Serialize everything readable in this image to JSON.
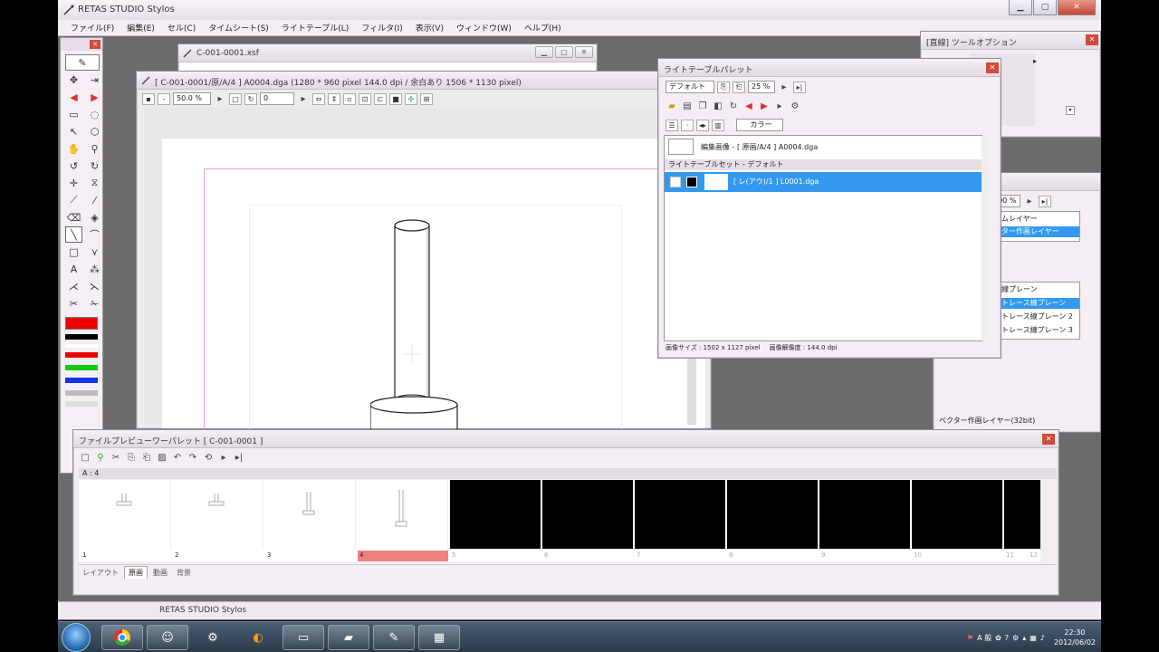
{
  "app": {
    "title": "RETAS STUDIO Stylos",
    "status": "RETAS STUDIO Stylos",
    "menus": [
      "ファイル(F)",
      "編集(E)",
      "セル(C)",
      "タイムシート(S)",
      "ライトテーブル(L)",
      "フィルタ(I)",
      "表示(V)",
      "ウィンドウ(W)",
      "ヘルプ(H)"
    ]
  },
  "xsf_window": {
    "title": "C-001-0001.xsf"
  },
  "doc_window": {
    "title": "[ C-001-0001/原/A/4 ] A0004.dga (1280 * 960 pixel 144.0 dpi / 余白あり 1506 * 1130 pixel)",
    "zoom": "50.0 %",
    "angle": "0"
  },
  "tool_options": {
    "title": "[直線] ツールオプション"
  },
  "lighttable": {
    "title": "ライトテーブルパレット",
    "preset": "デフォルト",
    "opacity": "25 %",
    "color_mode": "カラー",
    "edit_image_label": "編集画像 - [ 原画/A/4 ] A0004.dga",
    "set_header": "ライトテーブルセット - デフォルト",
    "set_row": "[ レ(アウ)/1 ] L0001.dga",
    "status_size": "画像サイズ : 1502 x 1127 pixel",
    "status_res": "画像解像度 : 144.0 dpi"
  },
  "layer_panel": {
    "opacity": "100 %",
    "layers": [
      "ムレイヤー",
      "ター作画レイヤー"
    ],
    "planes": [
      "線プレーン",
      "トレース線プレーン",
      "トレース線プレーン 2",
      "トレース線プレーン 3"
    ],
    "footer": "ベクター作画レイヤー(32bit)"
  },
  "preview": {
    "title": "ファイルプレビューワーパレット [ C-001-0001 ]",
    "track": "A : 4",
    "frame_numbers": [
      "1",
      "2",
      "3",
      "4",
      "5",
      "6",
      "7",
      "8",
      "9",
      "10",
      "11",
      "12"
    ],
    "tabs": [
      "レイアウト",
      "原画",
      "動画",
      "背景"
    ]
  },
  "taskbar": {
    "time": "22:30",
    "date": "2012/06/02",
    "ime": "A 般"
  },
  "colors": {
    "selection": "#3399ee",
    "current_frame": "#f08080"
  }
}
